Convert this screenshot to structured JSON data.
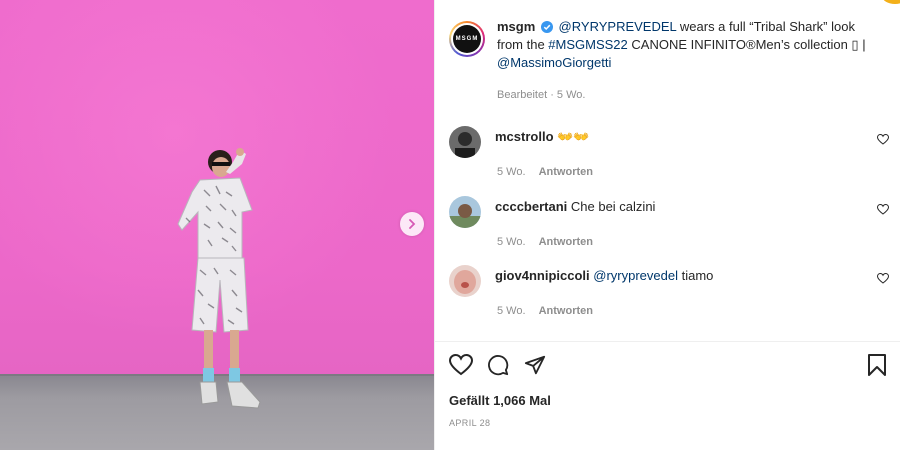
{
  "photo": {
    "next_button_icon": "chevron-right-icon",
    "accent": "#ec68c9"
  },
  "caption": {
    "username": "msgm",
    "avatar_text": "MSGM",
    "verified_icon": "verified-badge-icon",
    "mention": "@RYRYPREVEDEL",
    "text_a": " wears a full “Tribal Shark” look from the ",
    "hashtag": "#MSGMSS22",
    "text_b": " CANONE INFINITO®Men’s collection ▯ |",
    "mention2": "@MassimoGiorgetti",
    "meta": "Bearbeitet · 5 Wo."
  },
  "comments": [
    {
      "username": "mcstrollo",
      "text": "👐👐",
      "time": "5 Wo.",
      "reply": "Antworten"
    },
    {
      "username": "ccccbertani",
      "text": "Che bei calzini",
      "time": "5 Wo.",
      "reply": "Antworten"
    },
    {
      "username": "giov4nnipiccoli",
      "mention": "@ryryprevedel",
      "text": " tiamo",
      "time": "5 Wo.",
      "reply": "Antworten"
    }
  ],
  "actions": {
    "like_icon": "heart-icon",
    "comment_icon": "comment-icon",
    "share_icon": "paper-plane-icon",
    "save_icon": "bookmark-icon"
  },
  "likes": "Gefällt 1,066 Mal",
  "date": "APRIL 28",
  "colors": {
    "link": "#00376b",
    "secondary_text": "#8e8e8e",
    "verified": "#3897f0"
  }
}
